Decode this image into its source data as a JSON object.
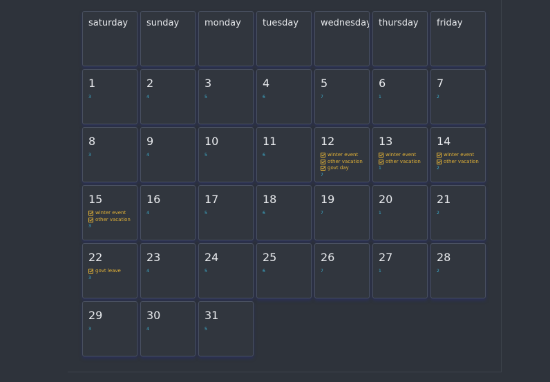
{
  "weekdays": [
    "saturday",
    "sunday",
    "monday",
    "tuesday",
    "wednesday",
    "thursday",
    "friday"
  ],
  "days": [
    {
      "num": "1",
      "events": [],
      "week": "3"
    },
    {
      "num": "2",
      "events": [],
      "week": "4"
    },
    {
      "num": "3",
      "events": [],
      "week": "5"
    },
    {
      "num": "4",
      "events": [],
      "week": "6"
    },
    {
      "num": "5",
      "events": [],
      "week": "7"
    },
    {
      "num": "6",
      "events": [],
      "week": "1"
    },
    {
      "num": "7",
      "events": [],
      "week": "2"
    },
    {
      "num": "8",
      "events": [],
      "week": "3"
    },
    {
      "num": "9",
      "events": [],
      "week": "4"
    },
    {
      "num": "10",
      "events": [],
      "week": "5"
    },
    {
      "num": "11",
      "events": [],
      "week": "6"
    },
    {
      "num": "12",
      "events": [
        "winter event",
        "other vacation",
        "govt day"
      ],
      "week": "7"
    },
    {
      "num": "13",
      "events": [
        "winter event",
        "other vacation"
      ],
      "week": "1"
    },
    {
      "num": "14",
      "events": [
        "winter event",
        "other vacation"
      ],
      "week": "2"
    },
    {
      "num": "15",
      "events": [
        "winter event",
        "other vacation"
      ],
      "week": "3"
    },
    {
      "num": "16",
      "events": [],
      "week": "4"
    },
    {
      "num": "17",
      "events": [],
      "week": "5"
    },
    {
      "num": "18",
      "events": [],
      "week": "6"
    },
    {
      "num": "19",
      "events": [],
      "week": "7"
    },
    {
      "num": "20",
      "events": [],
      "week": "1"
    },
    {
      "num": "21",
      "events": [],
      "week": "2"
    },
    {
      "num": "22",
      "events": [
        "govt leave"
      ],
      "week": "3"
    },
    {
      "num": "23",
      "events": [],
      "week": "4"
    },
    {
      "num": "24",
      "events": [],
      "week": "5"
    },
    {
      "num": "25",
      "events": [],
      "week": "6"
    },
    {
      "num": "26",
      "events": [],
      "week": "7"
    },
    {
      "num": "27",
      "events": [],
      "week": "1"
    },
    {
      "num": "28",
      "events": [],
      "week": "2"
    },
    {
      "num": "29",
      "events": [],
      "week": "3"
    },
    {
      "num": "30",
      "events": [],
      "week": "4"
    },
    {
      "num": "31",
      "events": [],
      "week": "5"
    }
  ],
  "colors": {
    "background": "#2e333b",
    "cell": "#31363e",
    "event": "#e2b237",
    "week_number": "#3db3d4"
  },
  "icons": {
    "event_marker": "checkbox-checked-icon"
  }
}
